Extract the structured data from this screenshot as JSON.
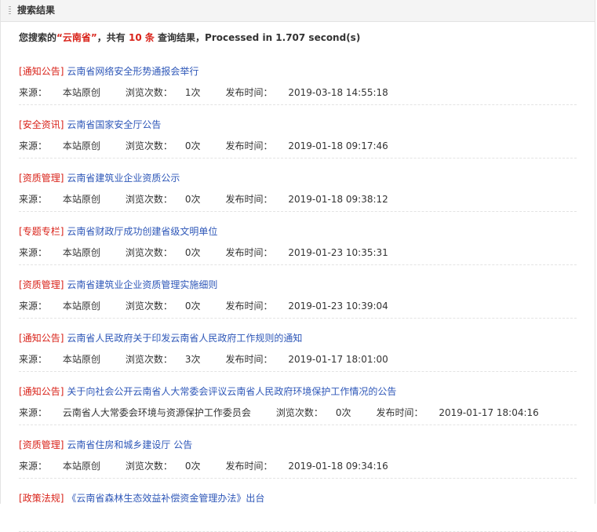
{
  "header": {
    "title": "搜索结果"
  },
  "summary": {
    "prefix": "您搜索的",
    "keyword": "“云南省”",
    "mid": "，共有 ",
    "count": "10 条",
    "suffix": " 查询结果，Processed in 1.707 second(s)"
  },
  "labels": {
    "source": "来源：",
    "views": "浏览次数：",
    "published": "发布时间："
  },
  "results": [
    {
      "category": "通知公告",
      "title": "云南省网络安全形势通报会举行",
      "source": "本站原创",
      "views": "1次",
      "time": "2019-03-18 14:55:18"
    },
    {
      "category": "安全资讯",
      "title": "云南省国家安全厅公告",
      "source": "本站原创",
      "views": "0次",
      "time": "2019-01-18 09:17:46"
    },
    {
      "category": "资质管理",
      "title": "云南省建筑业企业资质公示",
      "source": "本站原创",
      "views": "0次",
      "time": "2019-01-18 09:38:12"
    },
    {
      "category": "专题专栏",
      "title": "云南省财政厅成功创建省级文明单位",
      "source": "本站原创",
      "views": "0次",
      "time": "2019-01-23 10:35:31"
    },
    {
      "category": "资质管理",
      "title": "云南省建筑业企业资质管理实施细则",
      "source": "本站原创",
      "views": "0次",
      "time": "2019-01-23 10:39:04"
    },
    {
      "category": "通知公告",
      "title": "云南省人民政府关于印发云南省人民政府工作规则的通知",
      "source": "本站原创",
      "views": "3次",
      "time": "2019-01-17 18:01:00"
    },
    {
      "category": "通知公告",
      "title": "关于向社会公开云南省人大常委会评议云南省人民政府环境保护工作情况的公告",
      "source": "云南省人大常委会环境与资源保护工作委员会",
      "views": "0次",
      "time": "2019-01-17 18:04:16"
    },
    {
      "category": "资质管理",
      "title": "云南省住房和城乡建设厅 公告",
      "source": "本站原创",
      "views": "0次",
      "time": "2019-01-18 09:34:16"
    },
    {
      "category": "政策法规",
      "title": "《云南省森林生态效益补偿资金管理办法》出台",
      "source": "",
      "views": "",
      "time": ""
    }
  ]
}
